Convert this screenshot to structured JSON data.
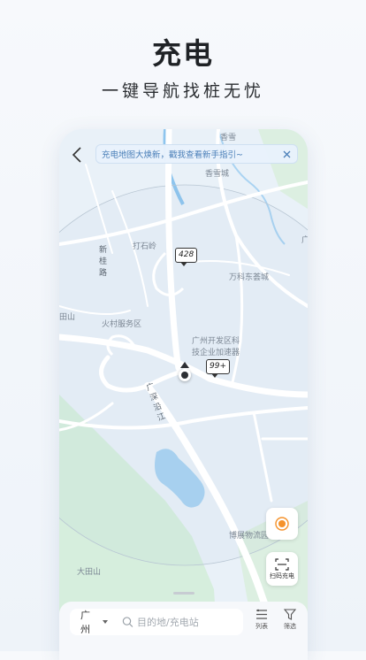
{
  "hero": {
    "title": "充电",
    "subtitle": "一键导航找桩无忧"
  },
  "notice": {
    "text": "充电地图大焕新，戳我查看新手指引~"
  },
  "map_labels": {
    "xiangxue": "香雪",
    "xiangxue_city": "香雪城",
    "zhongshi_ling": "打石岭",
    "xingui_lu": "新桂路",
    "vanke": "万科东荟城",
    "huocun": "火村服务区",
    "dev_zone_1": "广州开发区科",
    "dev_zone_2": "技企业加速器",
    "road_guangshen": "广深沿江",
    "boyi": "博展物流园",
    "dashan": "大田山",
    "left_shan": "田山",
    "right_edge": "广"
  },
  "pins": [
    {
      "count": "428"
    },
    {
      "count": "99+"
    }
  ],
  "fab": {
    "scan_label": "扫码充电"
  },
  "bottom_bar": {
    "city": "广州",
    "search_placeholder": "目的地/充电站",
    "list_label": "列表",
    "filter_label": "筛选"
  },
  "colors": {
    "accent_orange": "#f5922b",
    "notice_blue": "#4a7fb8",
    "map_base": "#e9f1f8",
    "park_green": "#d3ecd9",
    "water_blue": "#a9d3f2"
  }
}
